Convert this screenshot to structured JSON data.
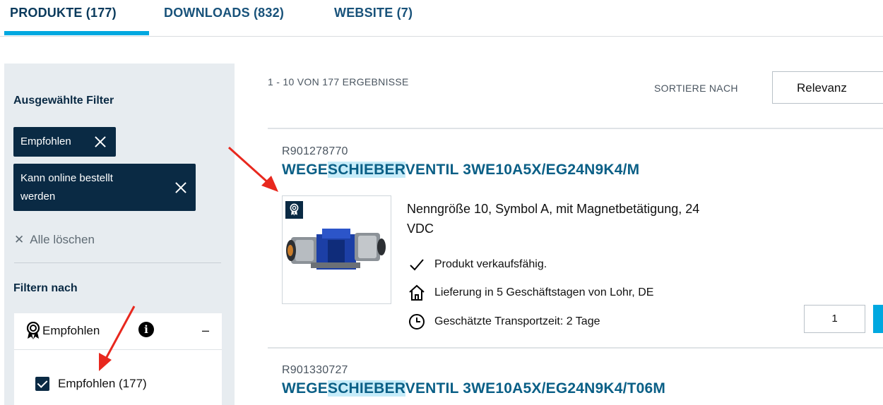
{
  "tabs": [
    {
      "label": "PRODUKTE (177)"
    },
    {
      "label": "DOWNLOADS (832)"
    },
    {
      "label": "WEBSITE (7)"
    }
  ],
  "sidebar": {
    "selected_heading": "Ausgewählte Filter",
    "chips": [
      {
        "label": "Empfohlen"
      },
      {
        "line1": "Kann online bestellt",
        "line2": "werden"
      }
    ],
    "clear_all": "Alle löschen",
    "filter_heading": "Filtern nach",
    "accordion": {
      "title": "Empfohlen",
      "option_label": "Empfohlen (177)"
    }
  },
  "results": {
    "count": "1 - 10 VON 177 ERGEBNISSE",
    "sort_label": "SORTIERE NACH",
    "sort_value": "Relevanz"
  },
  "products": [
    {
      "sku": "R901278770",
      "title_pre": "WEGE",
      "title_hl": "SCHIEBER",
      "title_post": "VENTIL 3WE10A5X/EG24N9K4/M",
      "desc_line1": "Nenngröße 10, Symbol A, mit Magnetbetätigung, 24",
      "desc_line2": "VDC",
      "feat_sellable": "Produkt verkaufsfähig.",
      "feat_delivery": "Lieferung in 5 Geschäftstagen von Lohr, DE",
      "feat_transport": "Geschätzte Transportzeit: 2 Tage",
      "quantity": "1"
    },
    {
      "sku": "R901330727",
      "title_pre": "WEGE",
      "title_hl": "SCHIEBER",
      "title_post": "VENTIL 3WE10A5X/EG24N9K4/T06M"
    }
  ],
  "colors": {
    "accent": "#00a8e0",
    "navy": "#0a2a44",
    "title_blue": "#0a5f86",
    "highlight": "#c6ecf9",
    "annotation_arrow": "#e8281e"
  }
}
